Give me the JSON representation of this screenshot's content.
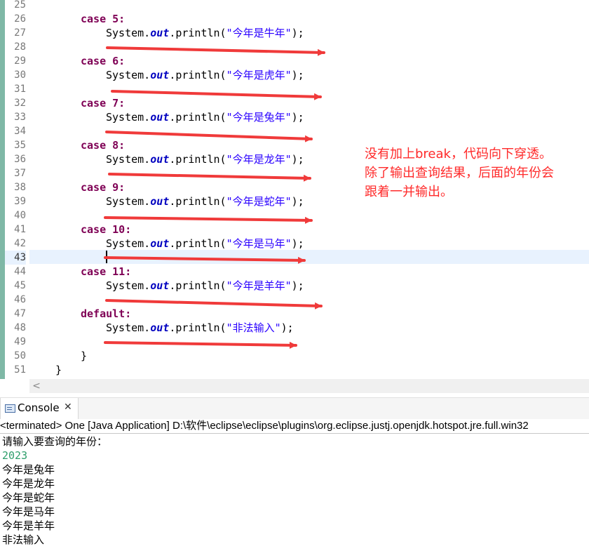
{
  "editor": {
    "current_line": "43",
    "line_numbers": [
      "25",
      "26",
      "27",
      "28",
      "29",
      "30",
      "31",
      "32",
      "33",
      "34",
      "35",
      "36",
      "37",
      "38",
      "39",
      "40",
      "41",
      "42",
      "43",
      "44",
      "45",
      "46",
      "47",
      "48",
      "49",
      "50",
      "51"
    ],
    "cases": [
      {
        "label": "case 5:",
        "message": "\"今年是牛年\""
      },
      {
        "label": "case 6:",
        "message": "\"今年是虎年\""
      },
      {
        "label": "case 7:",
        "message": "\"今年是兔年\""
      },
      {
        "label": "case 8:",
        "message": "\"今年是龙年\""
      },
      {
        "label": "case 9:",
        "message": "\"今年是蛇年\""
      },
      {
        "label": "case 10:",
        "message": "\"今年是马年\""
      },
      {
        "label": "case 11:",
        "message": "\"今年是羊年\""
      },
      {
        "label": "default:",
        "message": "\"非法输入\""
      }
    ],
    "println_prefix": "System.",
    "println_field": "out",
    "println_method": ".println(",
    "println_suffix": ");",
    "closing_brace_inner": "}",
    "closing_brace_outer": "}"
  },
  "annotation": {
    "lines": [
      "没有加上break，代码向下穿透。",
      "除了输出查询结果，后面的年份会",
      "跟着一并输出。"
    ],
    "color": "#ff2a2a"
  },
  "scrollbar": {
    "left_arrow": "<"
  },
  "console": {
    "tab_label": "Console",
    "tab_close": "✕",
    "tab_icon": "console-icon",
    "status": "<terminated> One [Java Application] D:\\软件\\eclipse\\eclipse\\plugins\\org.eclipse.justj.openjdk.hotspot.jre.full.win32",
    "output": [
      "请输入要查询的年份：",
      "2023",
      "今年是兔年",
      "今年是龙年",
      "今年是蛇年",
      "今年是马年",
      "今年是羊年",
      "非法输入"
    ],
    "input_color": "#2e9e6b"
  },
  "colors": {
    "keyword": "#7f0055",
    "field": "#0000c0",
    "string": "#2a00ff",
    "arrow": "#f03a3a",
    "current_line": "#e8f2fe"
  }
}
